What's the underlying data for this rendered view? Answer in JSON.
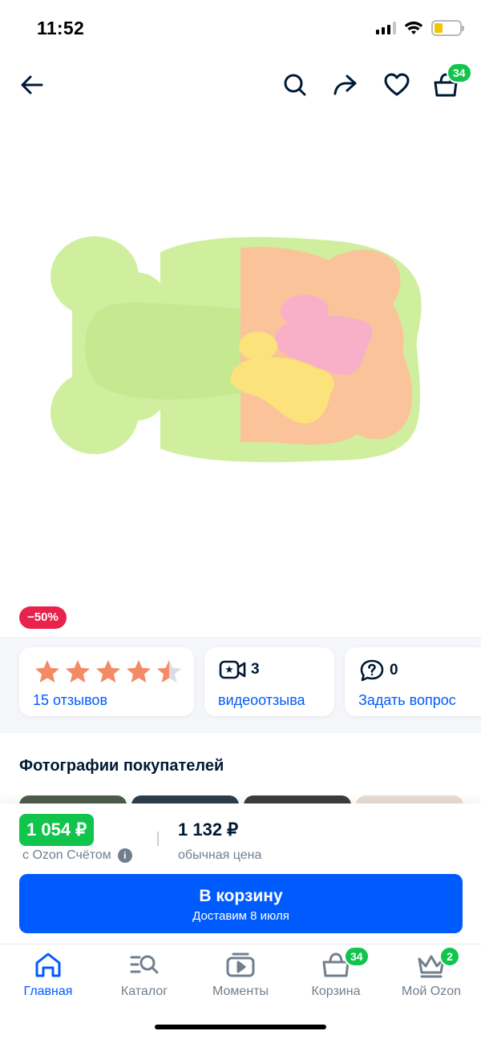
{
  "status_bar": {
    "time": "11:52"
  },
  "header": {
    "cart_count": "34"
  },
  "product": {
    "discount": "−50%",
    "rating": 4.5,
    "reviews_label": "15 отзывов",
    "video_count": "3",
    "video_label": "видеоотзыва",
    "questions_count": "0",
    "questions_label": "Задать вопрос"
  },
  "buyer_photos": {
    "title": "Фотографии покупателей"
  },
  "price": {
    "ozon_price": "1 054 ₽",
    "ozon_note": "с Ozon Счётом",
    "regular_price": "1 132 ₽",
    "regular_note": "обычная цена"
  },
  "cart_button": {
    "title": "В корзину",
    "subtitle": "Доставим 8 июля"
  },
  "tabs": [
    {
      "label": "Главная",
      "icon": "home-icon",
      "active": true
    },
    {
      "label": "Каталог",
      "icon": "catalog-icon"
    },
    {
      "label": "Моменты",
      "icon": "moments-icon"
    },
    {
      "label": "Корзина",
      "icon": "cart-icon",
      "badge": "34"
    },
    {
      "label": "Мой Ozon",
      "icon": "crown-icon",
      "badge": "2"
    }
  ],
  "colors": {
    "accent": "#005bff",
    "green": "#10c44c",
    "discount": "#e8224b",
    "star": "#f58b66",
    "bath_green": "#cfef9e",
    "bath_peach": "#fbc39a"
  }
}
